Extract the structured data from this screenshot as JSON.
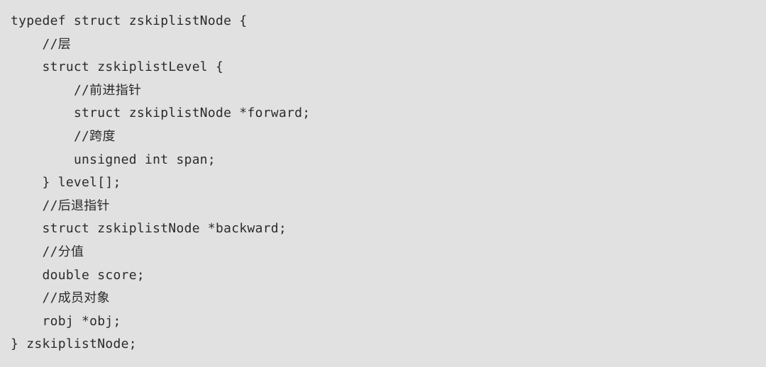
{
  "document": {
    "kind": "code-block",
    "language": "c",
    "background_color": "#e1e1e1",
    "text_color": "#2b2b2b",
    "lines": [
      {
        "indent": "",
        "text": "typedef struct zskiplistNode {"
      },
      {
        "indent": "    ",
        "text": "//层"
      },
      {
        "indent": "    ",
        "text": "struct zskiplistLevel {"
      },
      {
        "indent": "        ",
        "text": "//前进指针"
      },
      {
        "indent": "        ",
        "text": "struct zskiplistNode *forward;"
      },
      {
        "indent": "        ",
        "text": "//跨度"
      },
      {
        "indent": "        ",
        "text": "unsigned int span;"
      },
      {
        "indent": "    ",
        "text": "} level[];"
      },
      {
        "indent": "    ",
        "text": "//后退指针"
      },
      {
        "indent": "    ",
        "text": "struct zskiplistNode *backward;"
      },
      {
        "indent": "    ",
        "text": "//分值"
      },
      {
        "indent": "    ",
        "text": "double score;"
      },
      {
        "indent": "    ",
        "text": "//成员对象"
      },
      {
        "indent": "    ",
        "text": "robj *obj;"
      },
      {
        "indent": "",
        "text": "} zskiplistNode;"
      }
    ]
  }
}
